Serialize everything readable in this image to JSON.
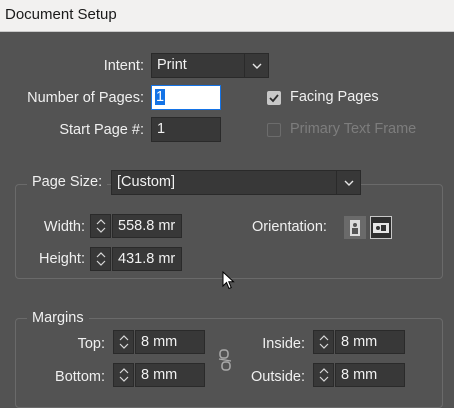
{
  "window": {
    "title": "Document Setup"
  },
  "intent": {
    "label": "Intent:",
    "value": "Print"
  },
  "num_pages": {
    "label": "Number of Pages:",
    "value": "1"
  },
  "start_page": {
    "label": "Start Page #:",
    "value": "1"
  },
  "facing_pages": {
    "label": "Facing Pages",
    "checked": true
  },
  "primary_text_frame": {
    "label": "Primary Text Frame",
    "checked": false,
    "enabled": false
  },
  "page_size": {
    "label": "Page Size:",
    "value": "[Custom]",
    "width_label": "Width:",
    "width_value": "558.8 mr",
    "height_label": "Height:",
    "height_value": "431.8 mr",
    "orientation_label": "Orientation:",
    "orientation_selected": "landscape"
  },
  "margins": {
    "legend": "Margins",
    "top_label": "Top:",
    "top_value": "8 mm",
    "bottom_label": "Bottom:",
    "bottom_value": "8 mm",
    "inside_label": "Inside:",
    "inside_value": "8 mm",
    "outside_label": "Outside:",
    "outside_value": "8 mm"
  },
  "icons": {
    "dropdown": "chevron-down-icon",
    "spinner": "stepper-arrows-icon",
    "link": "broken-chain-link-icon",
    "portrait": "portrait-page-icon",
    "landscape": "landscape-page-icon",
    "cursor": "mouse-pointer-icon"
  },
  "colors": {
    "dialog_bg": "#535353",
    "field_bg": "#383838",
    "focus_border": "#1473e6"
  }
}
